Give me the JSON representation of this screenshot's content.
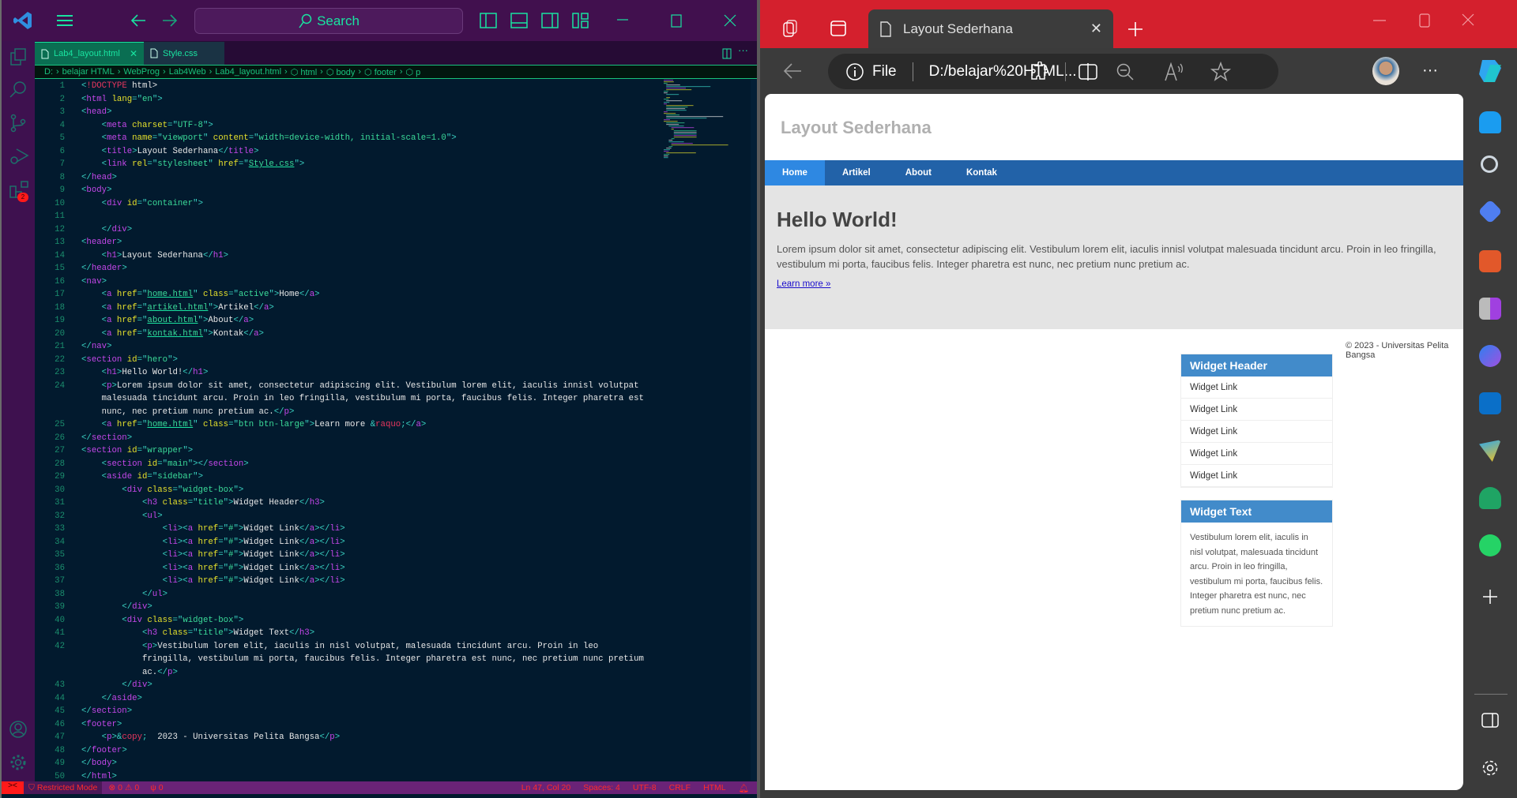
{
  "vscode": {
    "search_placeholder": "Search",
    "tabs": [
      {
        "label": "Lab4_layout.html",
        "active": true
      },
      {
        "label": "Style.css",
        "active": false
      }
    ],
    "breadcrumb": [
      "D:",
      "belajar HTML",
      "WebProg",
      "Lab4Web",
      "Lab4_layout.html",
      "html",
      "body",
      "footer",
      "p"
    ],
    "activity_badge": "2",
    "code_lines": [
      "<!DOCTYPE html>",
      "<html lang=\"en\">",
      "<head>",
      "    <meta charset=\"UTF-8\">",
      "    <meta name=\"viewport\" content=\"width=device-width, initial-scale=1.0\">",
      "    <title>Layout Sederhana</title>",
      "    <link rel=\"stylesheet\" href=\"Style.css\">",
      "</head>",
      "<body>",
      "    <div id=\"container\">",
      "",
      "    </div>",
      "<header>",
      "    <h1>Layout Sederhana</h1>",
      "</header>",
      "<nav>",
      "    <a href=\"home.html\" class=\"active\">Home</a>",
      "    <a href=\"artikel.html\">Artikel</a>",
      "    <a href=\"about.html\">About</a>",
      "    <a href=\"kontak.html\">Kontak</a>",
      "</nav>",
      "<section id=\"hero\">",
      "    <h1>Hello World!</h1>",
      "    <p>Lorem ipsum dolor sit amet, consectetur adipiscing elit. Vestibulum lorem elit, iaculis innisl volutpat malesuada tincidunt arcu. Proin in leo fringilla, vestibulum mi porta, faucibus felis. Integer pharetra est nunc, nec pretium nunc pretium ac.</p>",
      "    <a href=\"home.html\" class=\"btn btn-large\">Learn more &raquo;</a>",
      "</section>",
      "<section id=\"wrapper\">",
      "    <section id=\"main\"></section>",
      "    <aside id=\"sidebar\">",
      "        <div class=\"widget-box\">",
      "            <h3 class=\"title\">Widget Header</h3>",
      "            <ul>",
      "                <li><a href=\"#\">Widget Link</a></li>",
      "                <li><a href=\"#\">Widget Link</a></li>",
      "                <li><a href=\"#\">Widget Link</a></li>",
      "                <li><a href=\"#\">Widget Link</a></li>",
      "                <li><a href=\"#\">Widget Link</a></li>",
      "            </ul>",
      "        </div>",
      "        <div class=\"widget-box\">",
      "            <h3 class=\"title\">Widget Text</h3>",
      "            <p>Vestibulum lorem elit, iaculis in nisl volutpat, malesuada tincidunt arcu. Proin in leo fringilla, vestibulum mi porta, faucibus felis. Integer pharetra est nunc, nec pretium nunc pretium ac.</p>",
      "        </div>",
      "    </aside>",
      "</section>",
      "<footer>",
      "    <p>&copy;  2023 - Universitas Pelita Bangsa</p>",
      "</footer>",
      "</body>",
      "</html>"
    ],
    "status": {
      "mode": "Restricted Mode",
      "errors": "0",
      "warnings": "0",
      "ports": "0",
      "position": "Ln 47, Col 20",
      "spaces": "Spaces: 4",
      "encoding": "UTF-8",
      "eol": "CRLF",
      "language": "HTML"
    },
    "colors": {
      "accent": "#19e3a0",
      "title_bg": "#41104e",
      "editor_bg": "#021a2e",
      "status_bg": "#6a2377"
    }
  },
  "browser": {
    "tab_title": "Layout Sederhana",
    "address_scheme": "File",
    "address": "D:/belajar%20HTML...",
    "colors": {
      "tabbar": "#d4202d",
      "nav": "#2262a8",
      "nav_active": "#2e88e2",
      "widget_header": "#428bca"
    },
    "page": {
      "header_title": "Layout Sederhana",
      "nav": [
        {
          "label": "Home",
          "active": true
        },
        {
          "label": "Artikel"
        },
        {
          "label": "About"
        },
        {
          "label": "Kontak"
        }
      ],
      "hero_title": "Hello World!",
      "hero_text": "Lorem ipsum dolor sit amet, consectetur adipiscing elit. Vestibulum lorem elit, iaculis innisl volutpat malesuada tincidunt arcu. Proin in leo fringilla, vestibulum mi porta, faucibus felis. Integer pharetra est nunc, nec pretium nunc pretium ac.",
      "learn_more": "Learn more »",
      "widget1": {
        "title": "Widget Header",
        "links": [
          "Widget Link",
          "Widget Link",
          "Widget Link",
          "Widget Link",
          "Widget Link"
        ]
      },
      "widget2": {
        "title": "Widget Text",
        "text": "Vestibulum lorem elit, iaculis in nisl volutpat, malesuada tincidunt arcu. Proin in leo fringilla, vestibulum mi porta, faucibus felis. Integer pharetra est nunc, nec pretium nunc pretium ac."
      },
      "footer": "© 2023 - Universitas Pelita Bangsa"
    }
  }
}
